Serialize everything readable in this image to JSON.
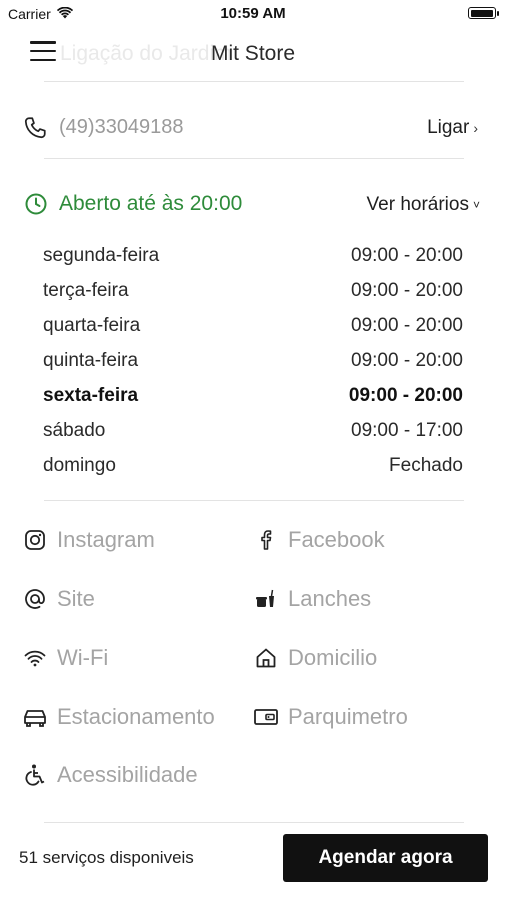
{
  "status_bar": {
    "carrier": "Carrier",
    "time": "10:59 AM",
    "battery_level": 1.0
  },
  "nav": {
    "title": "Mit Store",
    "ghost_title": "Ligação do Jardim"
  },
  "contact": {
    "phone": "(49)33049188",
    "call_label": "Ligar",
    "call_chevron": "›"
  },
  "status": {
    "open_text": "Aberto até às 20:00",
    "open_color": "#2e8b3a",
    "hours_toggle_label": "Ver horários",
    "toggle_chevron": "˅"
  },
  "hours": [
    {
      "day": "segunda-feira",
      "time": "09:00 - 20:00"
    },
    {
      "day": "terça-feira",
      "time": "09:00 - 20:00"
    },
    {
      "day": "quarta-feira",
      "time": "09:00 - 20:00"
    },
    {
      "day": "quinta-feira",
      "time": "09:00 - 20:00"
    },
    {
      "day": "sexta-feira",
      "time": "09:00 - 20:00"
    },
    {
      "day": "sábado",
      "time": "09:00 - 17:00"
    },
    {
      "day": "domingo",
      "time": "Fechado"
    }
  ],
  "today_index": 4,
  "amenities": [
    {
      "label": "Instagram",
      "icon": "instagram-icon"
    },
    {
      "label": "Facebook",
      "icon": "facebook-icon"
    },
    {
      "label": "Site",
      "icon": "at-icon"
    },
    {
      "label": "Lanches",
      "icon": "snack-icon"
    },
    {
      "label": "Wi-Fi",
      "icon": "wifi-icon"
    },
    {
      "label": "Domicilio",
      "icon": "home-icon"
    },
    {
      "label": "Estacionamento",
      "icon": "car-icon"
    },
    {
      "label": "Parquimetro",
      "icon": "parking-meter-icon"
    },
    {
      "label": "Acessibilidade",
      "icon": "accessibility-icon"
    }
  ],
  "footer": {
    "services_count": "51 serviços disponiveis",
    "book_label": "Agendar agora"
  }
}
